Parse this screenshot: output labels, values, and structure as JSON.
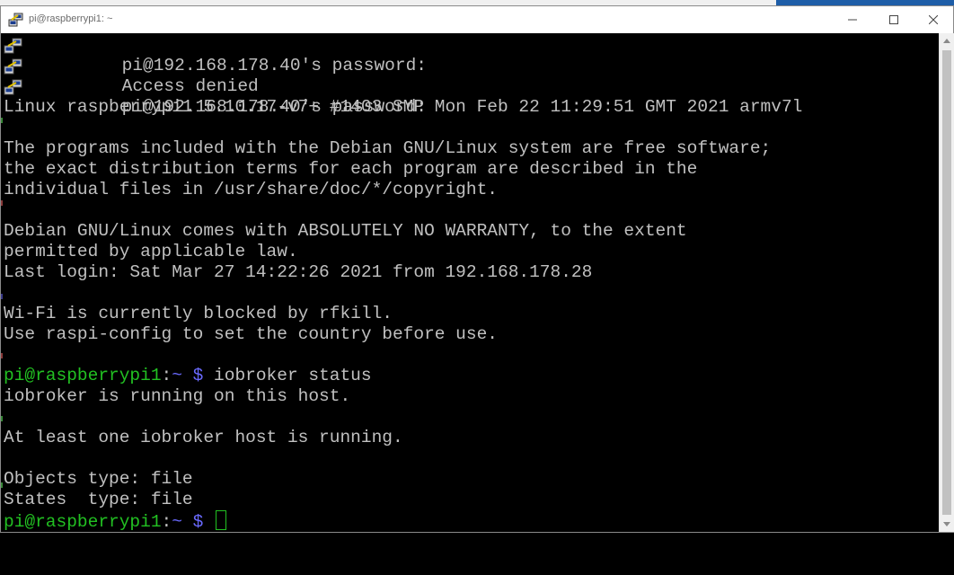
{
  "window": {
    "title": "pi@raspberrypi1: ~",
    "app_icon": "putty-icon",
    "controls": [
      "minimize-icon",
      "maximize-icon",
      "close-icon"
    ]
  },
  "colors": {
    "terminal_bg": "#000000",
    "terminal_text": "#c0c0c0",
    "prompt_user": "#22c022",
    "prompt_path": "#6a6aff",
    "cursor": "#22c022"
  },
  "terminal": {
    "system_messages": [
      "pi@192.168.178.40's password:",
      "Access denied",
      "pi@192.168.178.40's password:"
    ],
    "banner": "Linux raspberrypi1 5.10.17-v7+ #1403 SMP Mon Feb 22 11:29:51 GMT 2021 armv7l",
    "license": [
      "The programs included with the Debian GNU/Linux system are free software;",
      "the exact distribution terms for each program are described in the",
      "individual files in /usr/share/doc/*/copyright."
    ],
    "warranty": [
      "Debian GNU/Linux comes with ABSOLUTELY NO WARRANTY, to the extent",
      "permitted by applicable law."
    ],
    "last_login": "Last login: Sat Mar 27 14:22:26 2021 from 192.168.178.28",
    "wifi": [
      "Wi-Fi is currently blocked by rfkill.",
      "Use raspi-config to set the country before use."
    ],
    "prompt": {
      "user_host": "pi@raspberrypi1",
      "separator": ":",
      "path": "~",
      "symbol": " $ "
    },
    "command": "iobroker status",
    "output": [
      "iobroker is running on this host.",
      "At least one iobroker host is running.",
      "Objects type: file",
      "States  type: file"
    ],
    "current_input": ""
  }
}
